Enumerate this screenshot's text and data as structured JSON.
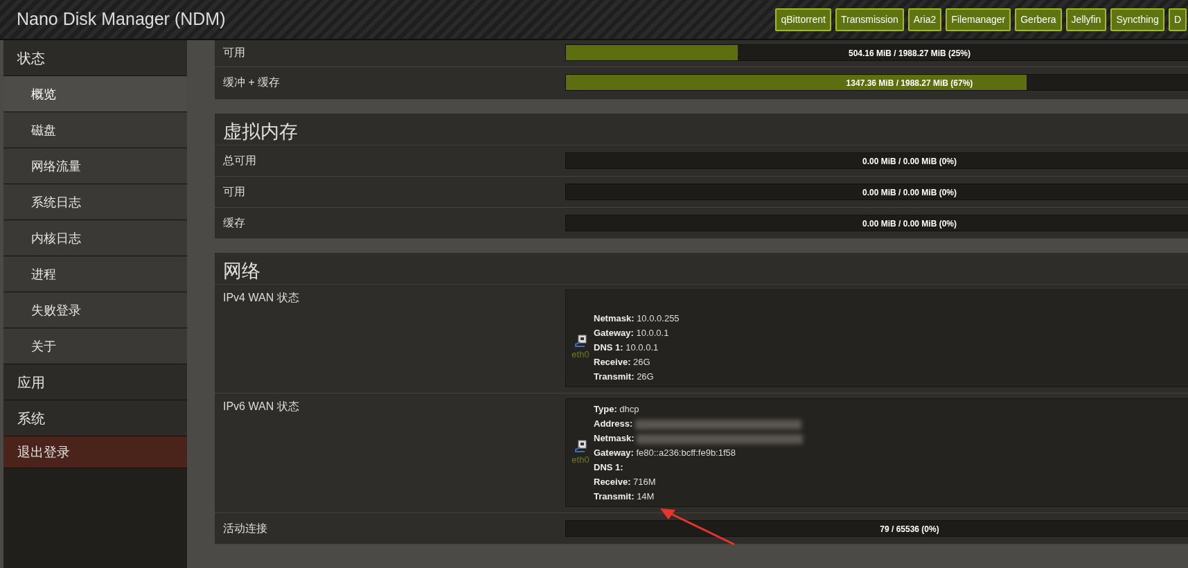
{
  "header": {
    "title": "Nano Disk Manager (NDM)",
    "apps": [
      "qBittorrent",
      "Transmission",
      "Aria2",
      "Filemanager",
      "Gerbera",
      "Jellyfin",
      "Syncthing",
      "D"
    ]
  },
  "sidebar": {
    "items": [
      {
        "label": "状态",
        "children": [
          {
            "label": "概览",
            "selected": true
          },
          {
            "label": "磁盘",
            "selected": false
          },
          {
            "label": "网络流量",
            "selected": false
          },
          {
            "label": "系统日志",
            "selected": false
          },
          {
            "label": "内核日志",
            "selected": false
          },
          {
            "label": "进程",
            "selected": false
          },
          {
            "label": "失败登录",
            "selected": false
          },
          {
            "label": "关于",
            "selected": false
          }
        ]
      },
      {
        "label": "应用"
      },
      {
        "label": "系统"
      },
      {
        "label": "退出登录",
        "kind": "logout"
      }
    ]
  },
  "sections": [
    {
      "rows": [
        {
          "kind": "bar",
          "label": "可用",
          "level": 0.25,
          "reading": "504.16 MiB / 1988.27 MiB (25%)"
        },
        {
          "kind": "bar",
          "label": "缓冲 + 缓存",
          "level": 0.67,
          "reading": "1347.36 MiB / 1988.27 MiB (67%)"
        }
      ]
    },
    {
      "title": "虚拟内存",
      "rows": [
        {
          "kind": "bar",
          "label": "总可用",
          "level": 0,
          "reading": "0.00 MiB / 0.00 MiB (0%)"
        },
        {
          "kind": "bar",
          "label": "可用",
          "level": 0,
          "reading": "0.00 MiB / 0.00 MiB (0%)"
        },
        {
          "kind": "bar",
          "label": "缓存",
          "level": 0,
          "reading": "0.00 MiB / 0.00 MiB (0%)"
        }
      ]
    },
    {
      "title": "网络",
      "rows": [
        {
          "kind": "iface",
          "label": "IPv4 WAN 状态",
          "device": "eth0",
          "fields": [
            {
              "key": "Netmask:",
              "value": "10.0.0.255"
            },
            {
              "key": "Gateway:",
              "value": "10.0.0.1"
            },
            {
              "key": "DNS 1:",
              "value": "10.0.0.1"
            },
            {
              "key": "Receive:",
              "value": "26G"
            },
            {
              "key": "Transmit:",
              "value": "26G"
            }
          ]
        },
        {
          "kind": "iface",
          "label": "IPv6 WAN 状态",
          "device": "eth0",
          "fields": [
            {
              "key": "Type:",
              "value": "dhcp"
            },
            {
              "key": "Address:",
              "redacted": true
            },
            {
              "key": "Netmask:",
              "redacted": true
            },
            {
              "key": "Gateway:",
              "value": "fe80::a236:bcff:fe9b:1f58"
            },
            {
              "key": "DNS 1:"
            },
            {
              "key": "Receive:",
              "value": "716M"
            },
            {
              "key": "Transmit:",
              "value": "14M"
            }
          ]
        },
        {
          "kind": "bar",
          "label": "活动连接",
          "level": 0,
          "reading": "79 / 65536 (0%)"
        }
      ]
    }
  ],
  "annotation": {
    "kind": "arrow"
  }
}
